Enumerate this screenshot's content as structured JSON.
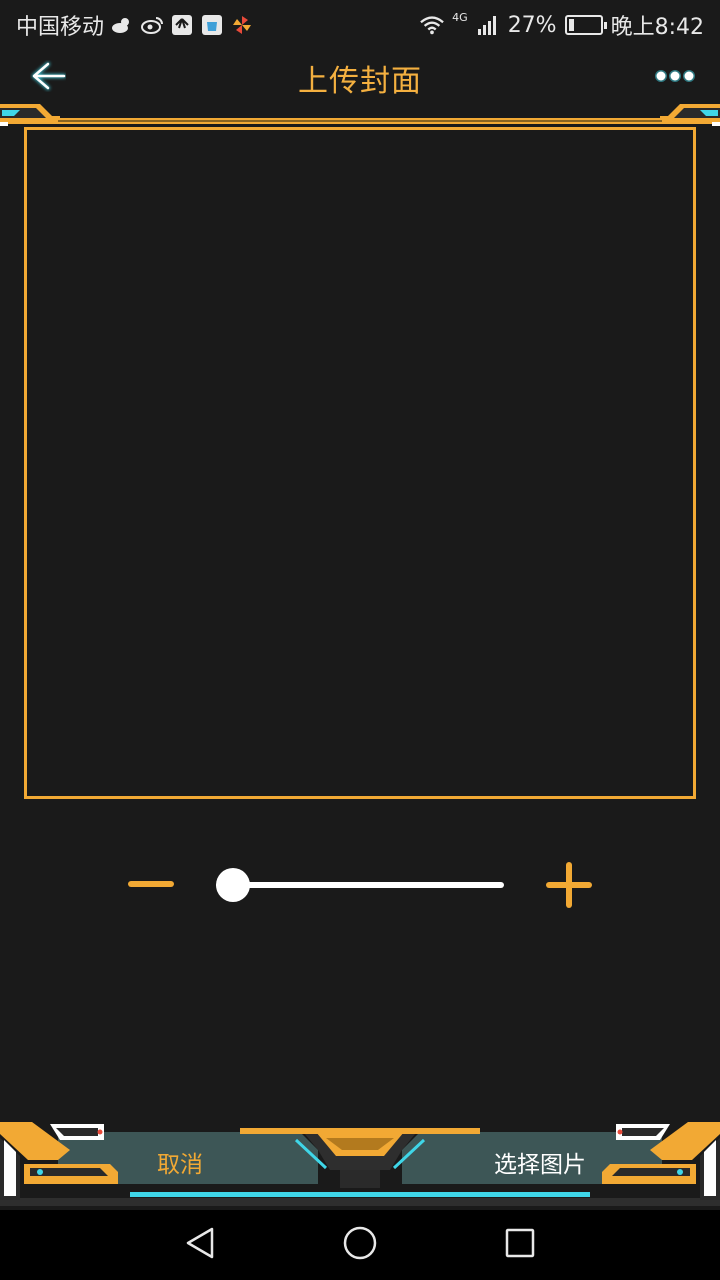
{
  "status_bar": {
    "carrier": "中国移动",
    "network": "4G",
    "battery_percent": "27%",
    "battery_level": 0.27,
    "time": "晚上8:42",
    "icons": [
      "cloud-weather-icon",
      "weibo-icon",
      "huawei-icon",
      "store-app-icon",
      "pinwheel-icon",
      "wifi-icon",
      "signal-icon",
      "battery-charging-icon"
    ]
  },
  "header": {
    "title": "上传封面",
    "back_icon": "arrow-left-icon",
    "more_icon": "more-dots-icon"
  },
  "zoom": {
    "minus_icon": "minus-icon",
    "plus_icon": "plus-icon",
    "slider_value": 0.06
  },
  "actions": {
    "cancel_label": "取消",
    "select_label": "选择图片"
  },
  "nav": {
    "back_icon": "nav-back-triangle-icon",
    "home_icon": "nav-home-circle-icon",
    "recents_icon": "nav-recents-square-icon"
  },
  "colors": {
    "accent": "#f2a934",
    "title": "#f4b040",
    "background": "#1a1a1a",
    "cyan": "#3fd6e8",
    "panel": "#3d5656"
  }
}
